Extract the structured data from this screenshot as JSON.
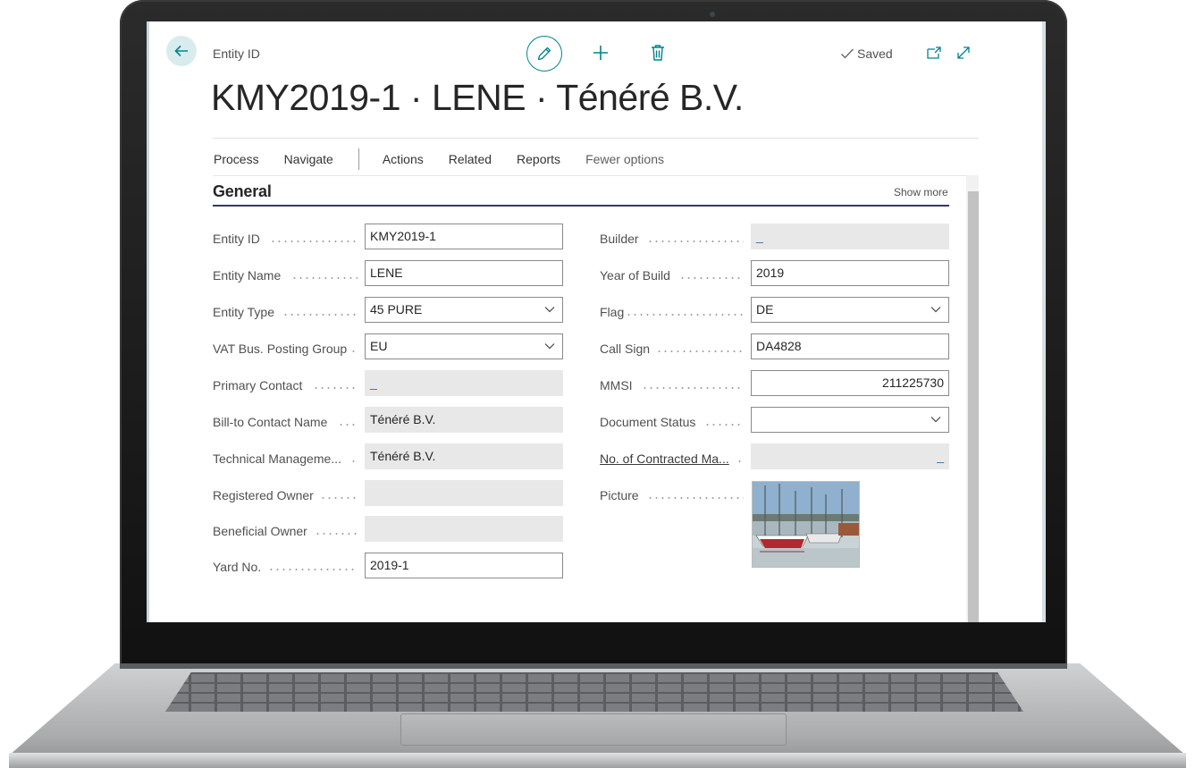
{
  "breadcrumb": "Entity ID",
  "title": "KMY2019-1 · LENE · Ténéré B.V.",
  "status": {
    "saved": "Saved"
  },
  "menu": {
    "items": [
      "Process",
      "Navigate",
      "Actions",
      "Related",
      "Reports"
    ],
    "fewer_options": "Fewer options"
  },
  "section": {
    "title": "General",
    "show_more": "Show more"
  },
  "left_fields": [
    {
      "label": "Entity ID",
      "value": "KMY2019-1"
    },
    {
      "label": "Entity Name",
      "value": "LENE"
    },
    {
      "label": "Entity Type",
      "value": "45 PURE"
    },
    {
      "label": "VAT Bus. Posting Group",
      "value": "EU"
    },
    {
      "label": "Primary Contact",
      "value": "_"
    },
    {
      "label": "Bill-to Contact Name",
      "value": "Ténéré B.V."
    },
    {
      "label": "Technical Manageme...",
      "value": "Ténéré B.V."
    },
    {
      "label": "Registered Owner",
      "value": ""
    },
    {
      "label": "Beneficial Owner",
      "value": ""
    },
    {
      "label": "Yard No.",
      "value": "2019-1"
    }
  ],
  "right_fields": [
    {
      "label": "Builder",
      "value": "_"
    },
    {
      "label": "Year of Build",
      "value": "2019"
    },
    {
      "label": "Flag",
      "value": "DE"
    },
    {
      "label": "Call Sign",
      "value": "DA4828"
    },
    {
      "label": "MMSI",
      "value": "211225730"
    },
    {
      "label": "Document Status",
      "value": ""
    },
    {
      "label": "No. of Contracted Ma...",
      "value": "_"
    },
    {
      "label": "Picture",
      "value": ""
    }
  ],
  "icons": {
    "back": "arrow-left-icon",
    "edit": "pencil-icon",
    "new": "plus-icon",
    "delete": "trash-icon",
    "saved": "checkmark-icon",
    "open_new_window": "open-in-new-window-icon",
    "expand": "expand-icon",
    "dropdown": "chevron-down-icon"
  },
  "colors": {
    "accent": "#00838f",
    "section_rule": "#343a5c",
    "readonly_bg": "#e8e8e9"
  }
}
